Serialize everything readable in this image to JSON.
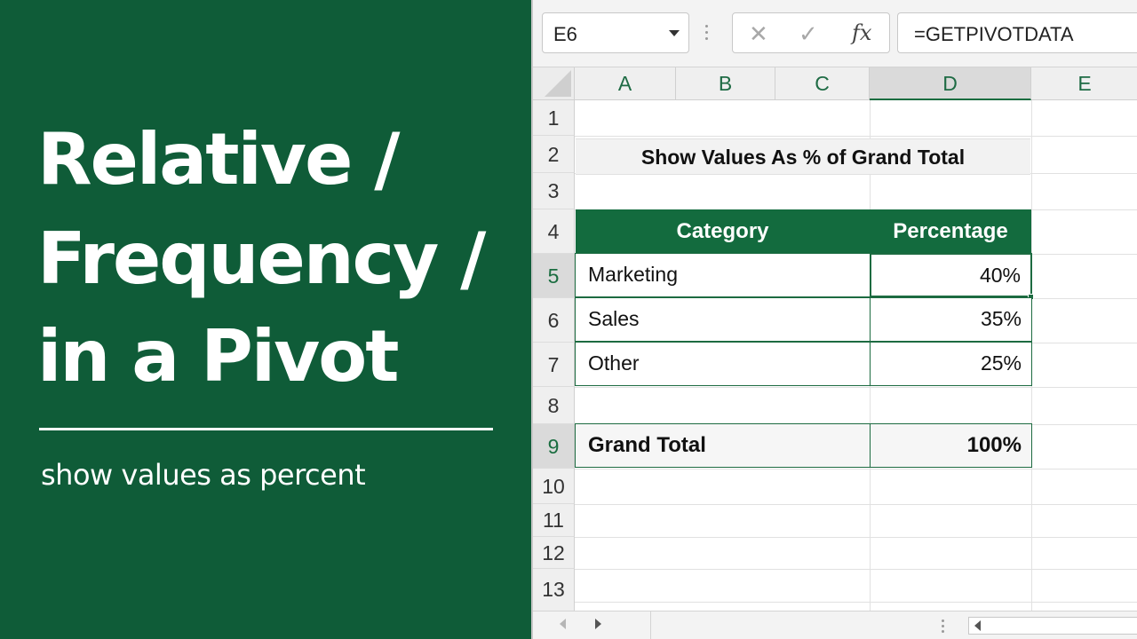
{
  "headline": {
    "lines": [
      "Relative /",
      "Frequency /",
      "in a Pivot"
    ],
    "subtitle": "show values as percent"
  },
  "formula_bar": {
    "name_box": "E6",
    "cancel_icon": "✕",
    "enter_icon": "✓",
    "fx_label": "fx",
    "formula": "=GETPIVOTDATA"
  },
  "columns": [
    "A",
    "B",
    "C",
    "D",
    "E"
  ],
  "rows": [
    "1",
    "2",
    "3",
    "4",
    "5",
    "6",
    "7",
    "8",
    "9",
    "10",
    "11",
    "12",
    "13"
  ],
  "sheet": {
    "title": "Show Values As % of Grand Total",
    "header": {
      "category": "Category",
      "percentage": "Percentage"
    },
    "data_rows": [
      {
        "category": "Marketing",
        "percentage": "40%"
      },
      {
        "category": "Sales",
        "percentage": "35%"
      },
      {
        "category": "Other",
        "percentage": "25%"
      }
    ],
    "grand_total": {
      "label": "Grand Total",
      "value": "100%"
    }
  },
  "colors": {
    "panel_green": "#0f5c38",
    "header_green": "#136b3e",
    "border_green": "#1d6b41"
  }
}
